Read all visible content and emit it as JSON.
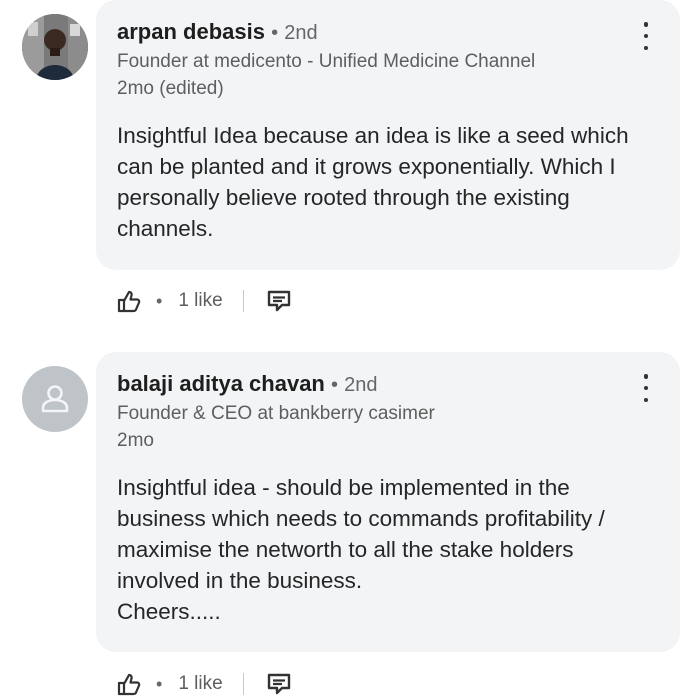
{
  "comments": [
    {
      "name": "arpan debasis",
      "separator": "•",
      "degree": "2nd",
      "headline": "Founder at medicento - Unified Medicine Channel",
      "time": "2mo (edited)",
      "text": "Insightful Idea because an idea is like a seed which can be planted and it grows exponentially. Which I personally believe rooted through the existing channels.",
      "likes_label": "1 like",
      "avatar": "profile-photo"
    },
    {
      "name": "balaji aditya chavan",
      "separator": "•",
      "degree": "2nd",
      "headline": "Founder & CEO at bankberry casimer",
      "time": "2mo",
      "text": "Insightful idea - should be implemented in the business which needs to commands profitability / maximise the networth to all the stake holders involved in the business.\nCheers.....",
      "likes_label": "1 like",
      "avatar": "default-person-icon"
    }
  ],
  "action_separator": "•",
  "icons": {
    "like": "thumbs-up-icon",
    "reply": "reply-icon",
    "more": "more-options-icon"
  },
  "colors": {
    "bubble": "#f2f4f6",
    "avatar_placeholder": "#bfc4c9"
  }
}
